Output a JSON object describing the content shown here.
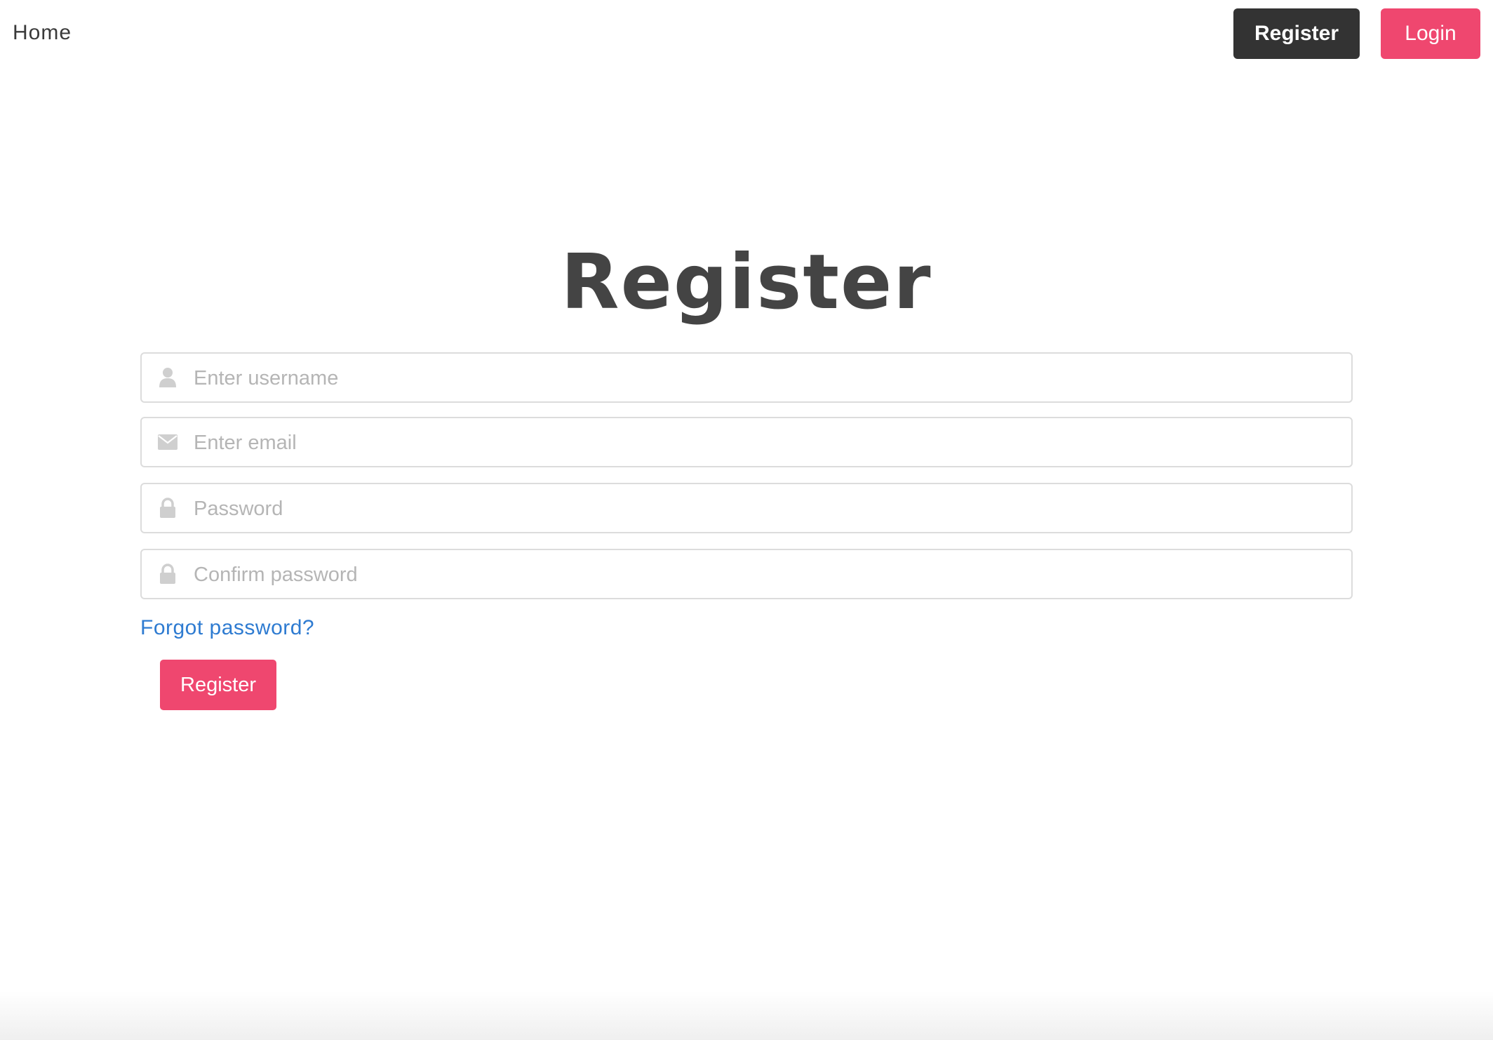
{
  "nav": {
    "home_label": "Home",
    "register_label": "Register",
    "login_label": "Login"
  },
  "page": {
    "title": "Register"
  },
  "form": {
    "username_placeholder": "Enter username",
    "email_placeholder": "Enter email",
    "password_placeholder": "Password",
    "confirm_placeholder": "Confirm password",
    "username_icon": "user-icon",
    "email_icon": "envelope-icon",
    "password_icon": "lock-icon",
    "confirm_icon": "lock-icon",
    "forgot_label": "Forgot password?",
    "submit_label": "Register"
  },
  "colors": {
    "accent": "#ef476f",
    "dark": "#333333",
    "link": "#2e7bd1",
    "title": "#444444"
  }
}
